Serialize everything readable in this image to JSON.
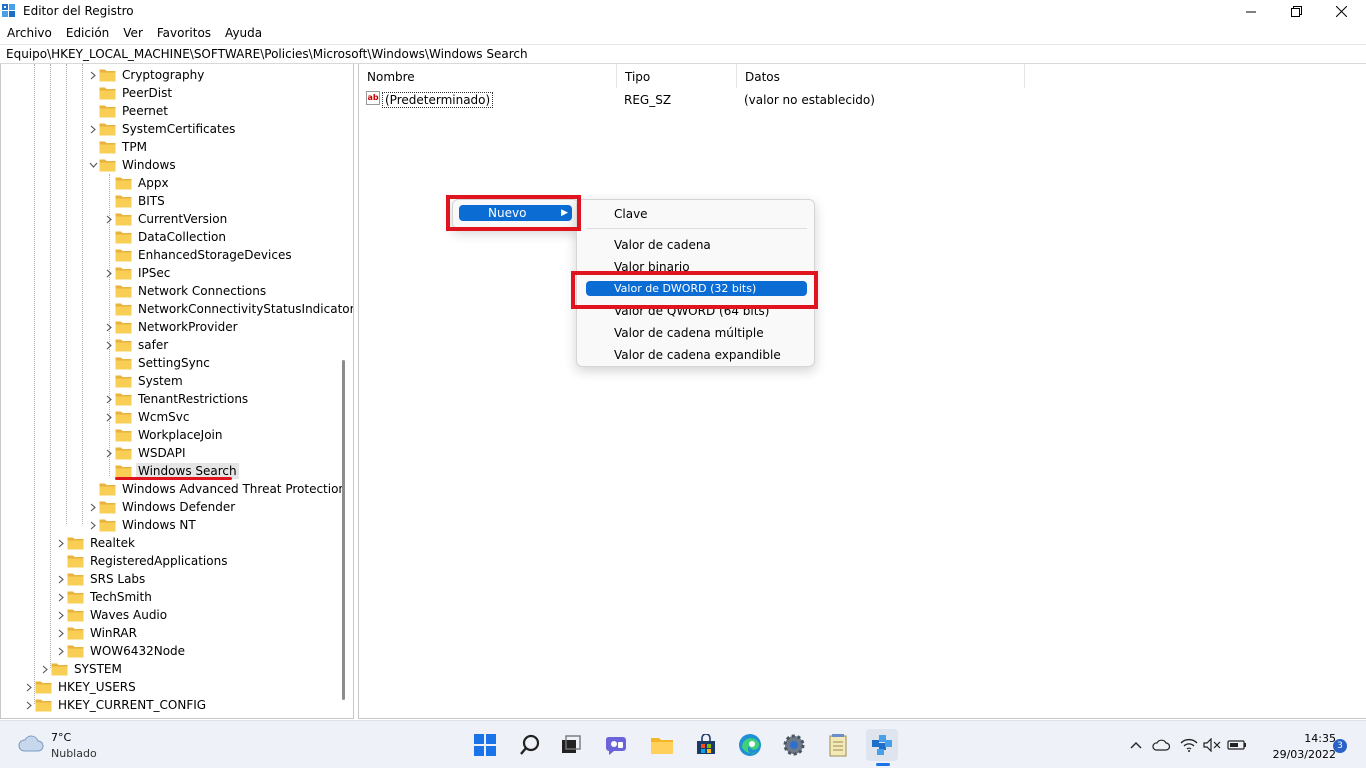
{
  "window": {
    "title": "Editor del Registro",
    "icon": "registry-editor-icon"
  },
  "menubar": [
    "Archivo",
    "Edición",
    "Ver",
    "Favoritos",
    "Ayuda"
  ],
  "address": "Equipo\\HKEY_LOCAL_MACHINE\\SOFTWARE\\Policies\\Microsoft\\Windows\\Windows Search",
  "tree": {
    "items": [
      {
        "label": "Cryptography",
        "level": 2,
        "expander": "collapsed"
      },
      {
        "label": "PeerDist",
        "level": 2,
        "expander": "none"
      },
      {
        "label": "Peernet",
        "level": 2,
        "expander": "none"
      },
      {
        "label": "SystemCertificates",
        "level": 2,
        "expander": "collapsed"
      },
      {
        "label": "TPM",
        "level": 2,
        "expander": "none"
      },
      {
        "label": "Windows",
        "level": 2,
        "expander": "expanded"
      },
      {
        "label": "Appx",
        "level": 3,
        "expander": "none"
      },
      {
        "label": "BITS",
        "level": 3,
        "expander": "none"
      },
      {
        "label": "CurrentVersion",
        "level": 3,
        "expander": "collapsed"
      },
      {
        "label": "DataCollection",
        "level": 3,
        "expander": "none"
      },
      {
        "label": "EnhancedStorageDevices",
        "level": 3,
        "expander": "none"
      },
      {
        "label": "IPSec",
        "level": 3,
        "expander": "collapsed"
      },
      {
        "label": "Network Connections",
        "level": 3,
        "expander": "none"
      },
      {
        "label": "NetworkConnectivityStatusIndicator",
        "level": 3,
        "expander": "none"
      },
      {
        "label": "NetworkProvider",
        "level": 3,
        "expander": "collapsed"
      },
      {
        "label": "safer",
        "level": 3,
        "expander": "collapsed"
      },
      {
        "label": "SettingSync",
        "level": 3,
        "expander": "none"
      },
      {
        "label": "System",
        "level": 3,
        "expander": "none"
      },
      {
        "label": "TenantRestrictions",
        "level": 3,
        "expander": "collapsed"
      },
      {
        "label": "WcmSvc",
        "level": 3,
        "expander": "collapsed"
      },
      {
        "label": "WorkplaceJoin",
        "level": 3,
        "expander": "none"
      },
      {
        "label": "WSDAPI",
        "level": 3,
        "expander": "collapsed"
      },
      {
        "label": "Windows Search",
        "level": 3,
        "expander": "none",
        "selected": true
      },
      {
        "label": "Windows Advanced Threat Protection",
        "level": 2,
        "expander": "none"
      },
      {
        "label": "Windows Defender",
        "level": 2,
        "expander": "collapsed"
      },
      {
        "label": "Windows NT",
        "level": 2,
        "expander": "collapsed"
      },
      {
        "label": "Realtek",
        "level": 1,
        "expander": "collapsed"
      },
      {
        "label": "RegisteredApplications",
        "level": 1,
        "expander": "none"
      },
      {
        "label": "SRS Labs",
        "level": 1,
        "expander": "collapsed"
      },
      {
        "label": "TechSmith",
        "level": 1,
        "expander": "collapsed"
      },
      {
        "label": "Waves Audio",
        "level": 1,
        "expander": "collapsed"
      },
      {
        "label": "WinRAR",
        "level": 1,
        "expander": "collapsed"
      },
      {
        "label": "WOW6432Node",
        "level": 1,
        "expander": "collapsed"
      },
      {
        "label": "SYSTEM",
        "level": 0,
        "expander": "collapsed"
      },
      {
        "label": "HKEY_USERS",
        "level": -1,
        "expander": "collapsed"
      },
      {
        "label": "HKEY_CURRENT_CONFIG",
        "level": -1,
        "expander": "collapsed"
      }
    ]
  },
  "list": {
    "headers": {
      "name": "Nombre",
      "type": "Tipo",
      "data": "Datos"
    },
    "rows": [
      {
        "icon": "string-value-icon",
        "icon_text": "ab",
        "name": "(Predeterminado)",
        "type": "REG_SZ",
        "data": "(valor no establecido)"
      }
    ]
  },
  "context_menu": {
    "item": "Nuevo",
    "submenu": [
      "Clave",
      "Valor de cadena",
      "Valor binario",
      "Valor de DWORD (32 bits)",
      "Valor de QWORD (64 bits)",
      "Valor de cadena múltiple",
      "Valor de cadena expandible"
    ],
    "highlight_color": "#0b6cd4"
  },
  "annotation_color": "#e0141e",
  "taskbar": {
    "weather": {
      "temp": "7°C",
      "desc": "Nublado"
    },
    "clock": {
      "time": "14:35",
      "date": "29/03/2022"
    },
    "notification_count": "3",
    "apps": [
      "windows-start-icon",
      "search-icon",
      "task-view-icon",
      "teams-chat-icon",
      "file-explorer-icon",
      "microsoft-store-icon",
      "edge-icon",
      "settings-icon",
      "notepad-icon",
      "registry-editor-icon"
    ],
    "tray": [
      "chevron-up-icon",
      "cloud-icon",
      "wifi-icon",
      "volume-muted-icon",
      "battery-icon"
    ]
  }
}
